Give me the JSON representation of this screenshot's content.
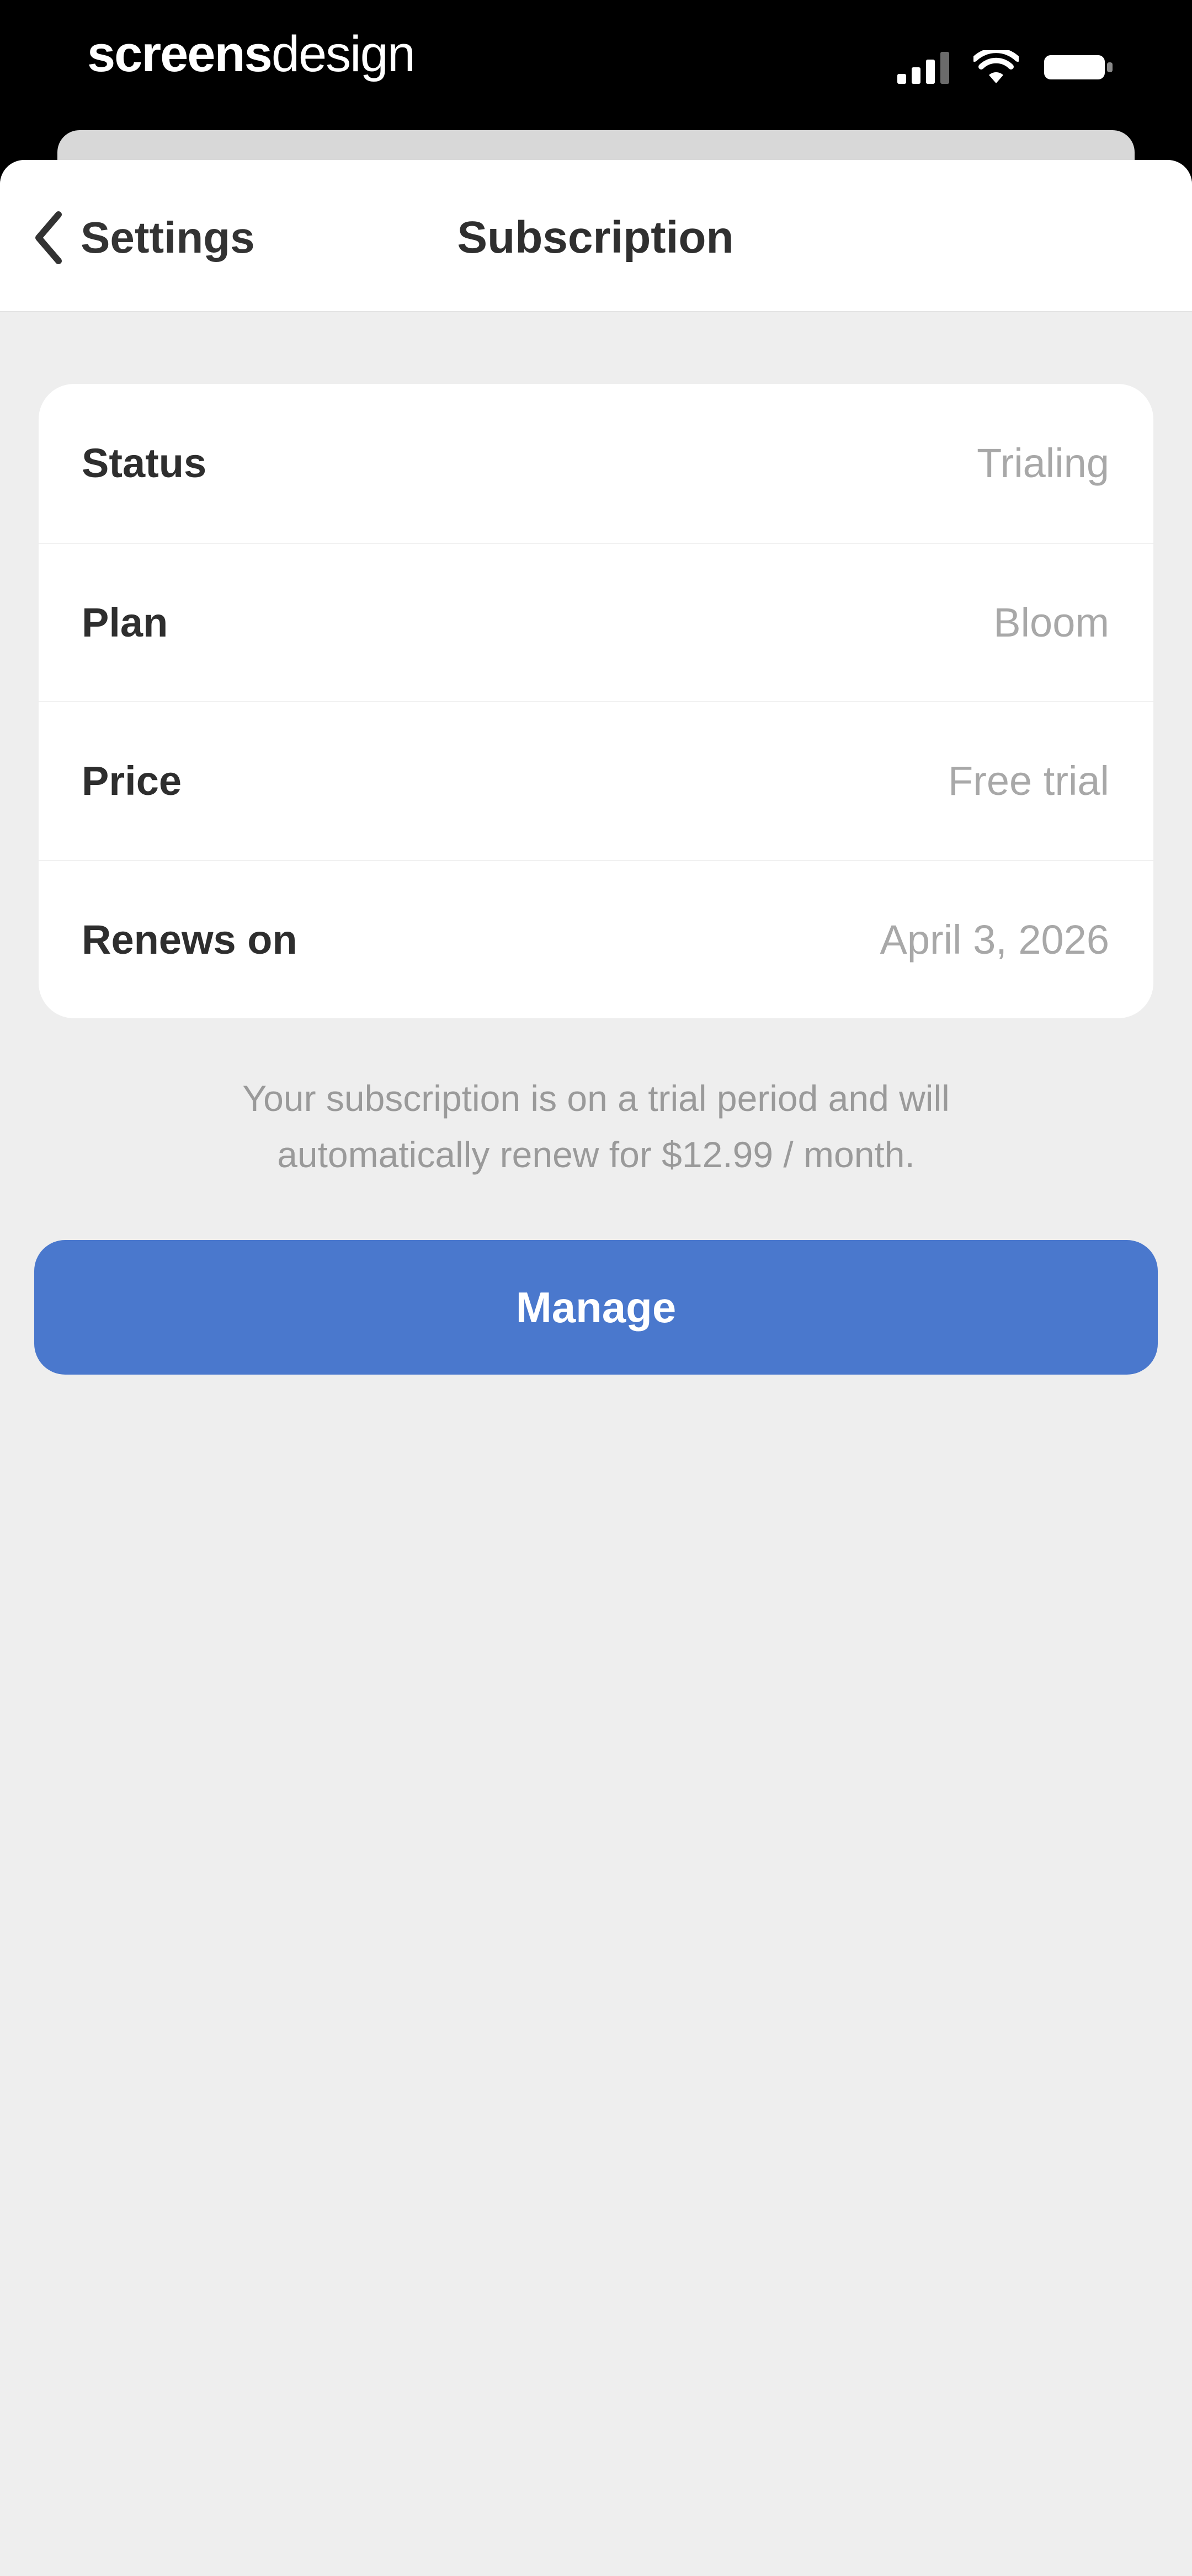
{
  "status_bar": {
    "brand_bold": "screens",
    "brand_light": "design",
    "icons": [
      "signal-icon",
      "wifi-icon",
      "battery-icon"
    ]
  },
  "nav": {
    "back_label": "Settings",
    "title": "Subscription"
  },
  "details": {
    "rows": [
      {
        "label": "Status",
        "value": "Trialing"
      },
      {
        "label": "Plan",
        "value": "Bloom"
      },
      {
        "label": "Price",
        "value": "Free trial"
      },
      {
        "label": "Renews on",
        "value": "April 3, 2026"
      }
    ]
  },
  "info": {
    "line1": "Your subscription is on a trial period and will",
    "line2": "automatically renew for $12.99 / month."
  },
  "actions": {
    "manage_label": "Manage"
  },
  "colors": {
    "accent": "#4a78cd",
    "background": "#eeeeee",
    "card": "#ffffff",
    "label_text": "#2e2e2e",
    "value_text": "#a8a8a8"
  }
}
